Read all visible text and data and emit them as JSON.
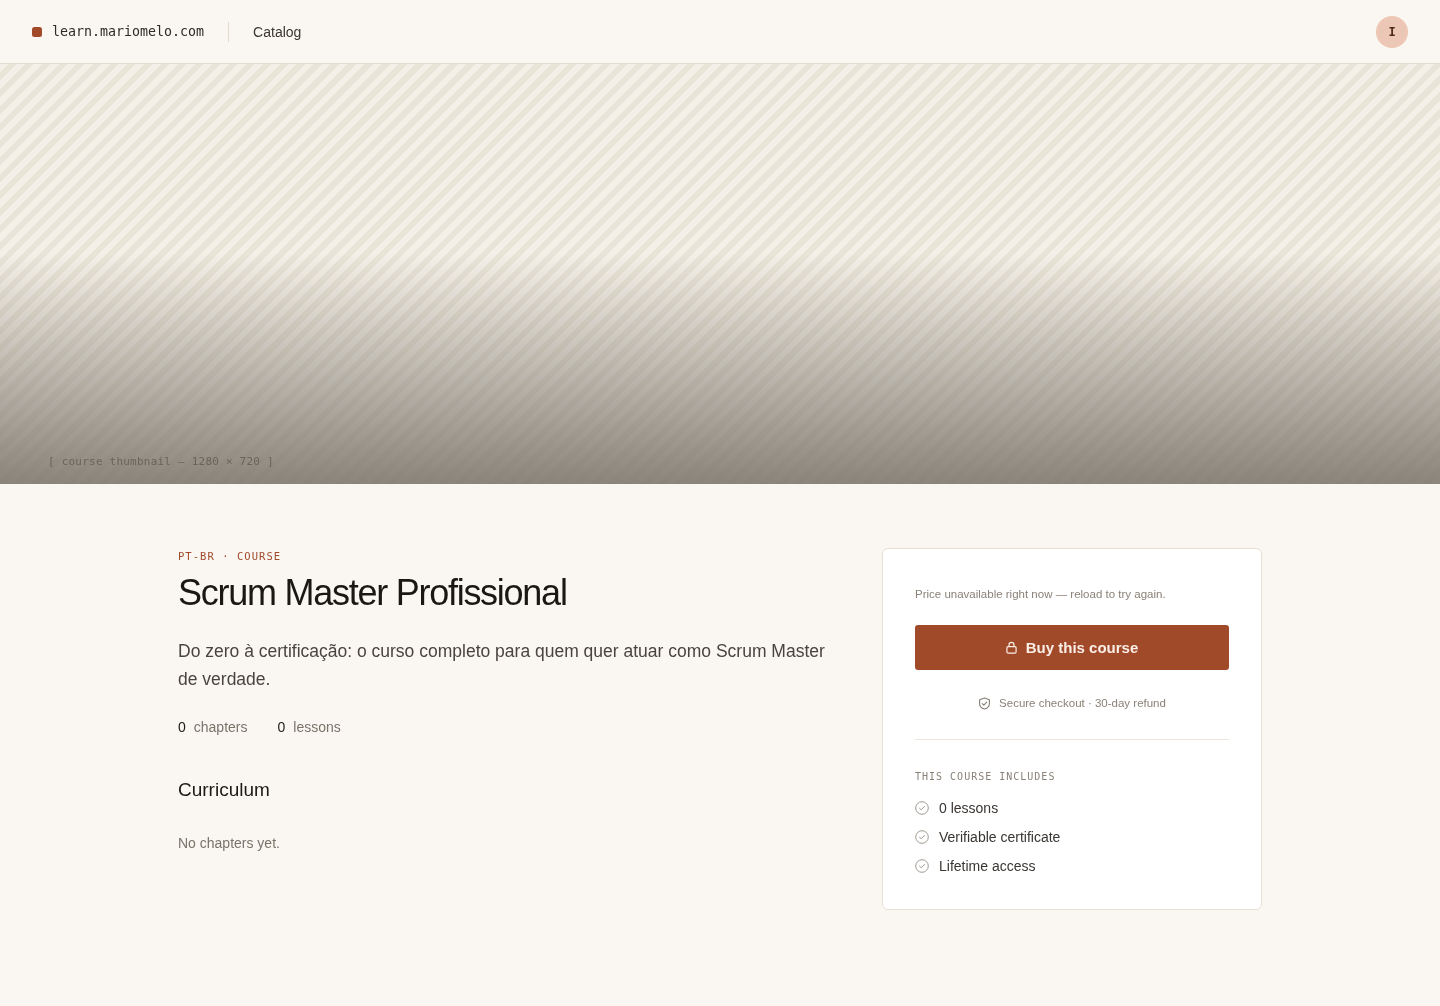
{
  "header": {
    "site": "learn.mariomelo.com",
    "nav": [
      "Catalog"
    ],
    "avatar": "I"
  },
  "hero": {
    "label": "[ course thumbnail — 1280 × 720 ]"
  },
  "course": {
    "eyebrow": "PT-BR · COURSE",
    "title": "Scrum Master Profissional",
    "description": "Do zero à certificação: o curso completo para quem quer atuar como Scrum Master de verdade.",
    "stats": [
      {
        "value": "0",
        "label": "chapters"
      },
      {
        "value": "0",
        "label": "lessons"
      }
    ]
  },
  "curriculum": {
    "heading": "Curriculum",
    "empty": "No chapters yet."
  },
  "purchase": {
    "notice": "Price unavailable right now — reload to try again.",
    "button": "Buy this course",
    "guarantee": "Secure checkout · 30-day refund",
    "includes_heading": "THIS COURSE INCLUDES",
    "includes": [
      "0 lessons",
      "Verifiable certificate",
      "Lifetime access"
    ]
  }
}
